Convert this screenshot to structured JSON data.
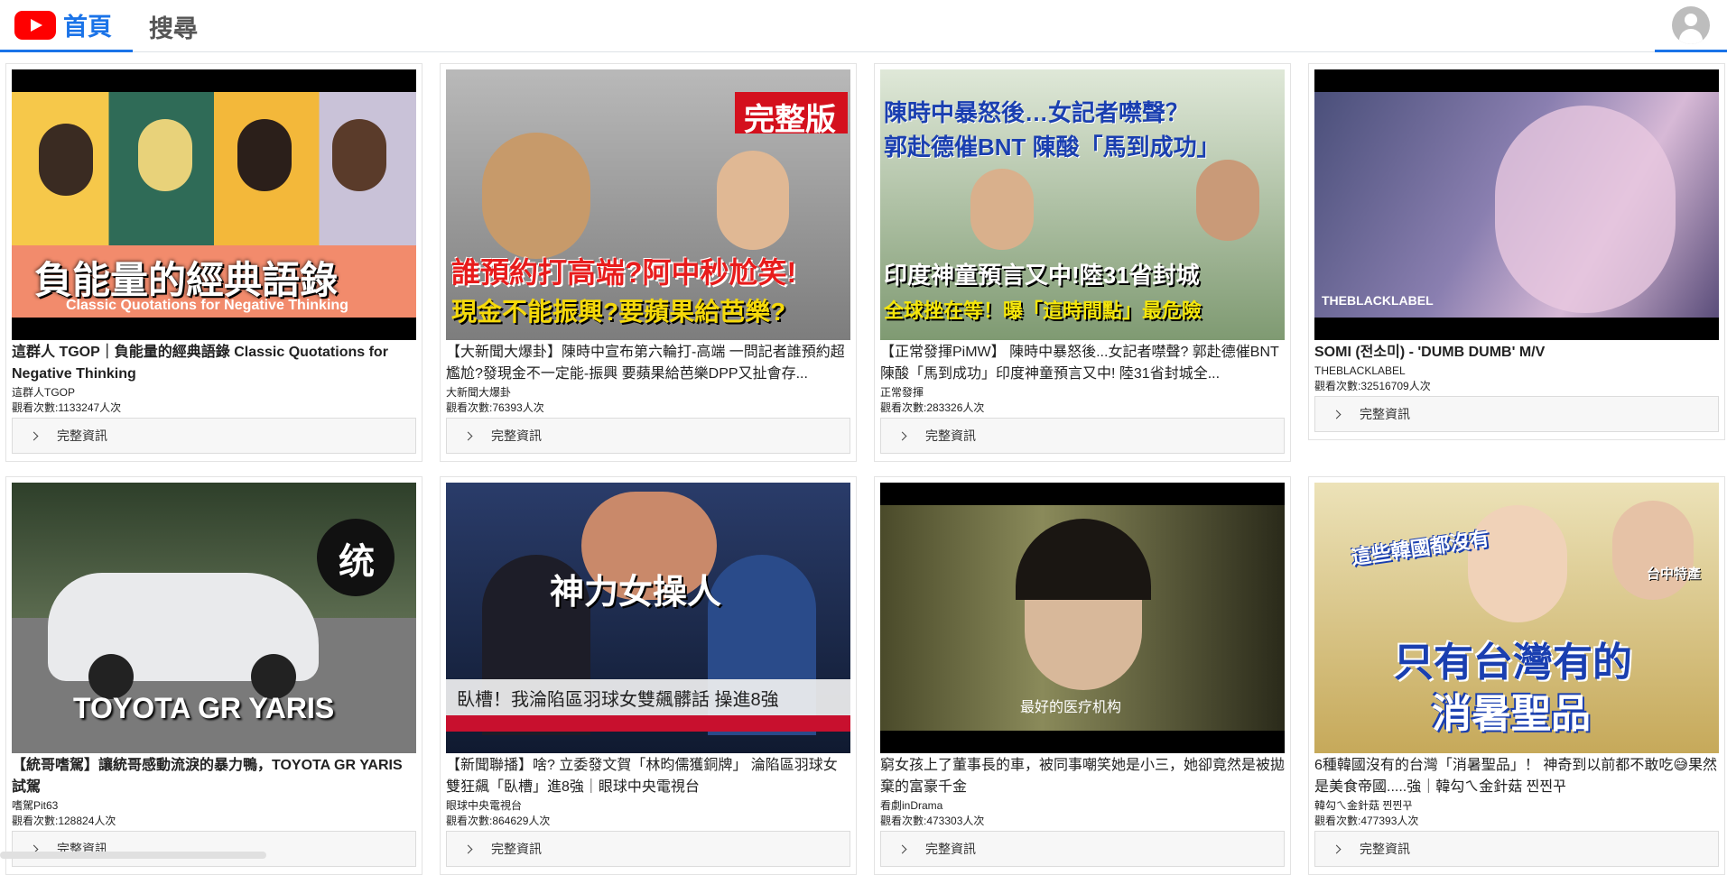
{
  "nav": {
    "home_label": "首頁",
    "search_label": "搜尋"
  },
  "details_label": "完整資訊",
  "videos": [
    {
      "title": "這群人 TGOP｜負能量的經典語錄 Classic Quotations for Negative Thinking",
      "channel": "這群人TGOP",
      "views": "觀看次數:1133247人次",
      "thumb_text": [
        "負能量的經典語錄",
        "Classic Quotations for Negative Thinking"
      ]
    },
    {
      "title": "【大新聞大爆卦】陳時中宣布第六輪打-高端 一問記者誰預約超尷尬?發現金不一定能-振興 要蘋果給芭樂DPP又扯會存...",
      "channel": "大新聞大爆卦",
      "views": "觀看次數:76393人次",
      "thumb_text": [
        "完整版",
        "誰預約打高端?阿中秒尬笑!",
        "現金不能振興?要蘋果給芭樂?"
      ]
    },
    {
      "title": "【正常發揮PiMW】 陳時中暴怒後...女記者噤聲? 郭赴德催BNT 陳酸「馬到成功」印度神童預言又中! 陸31省封城全...",
      "channel": "正常發揮",
      "views": "觀看次數:283326人次",
      "thumb_text": [
        "陳時中暴怒後…女記者噤聲？",
        "郭赴德催BNT 陳酸「馬到成功」",
        "印度神童預言又中!陸31省封城",
        "全球挫在等！曝「這時間點」最危險"
      ]
    },
    {
      "title": "SOMI (전소미) - 'DUMB DUMB' M/V",
      "channel": "THEBLACKLABEL",
      "views": "觀看次數:32516709人次",
      "thumb_text": [
        "THEBLACKLABEL"
      ]
    },
    {
      "title": "【統哥嗜駕】讓統哥感動流淚的暴力鴨，TOYOTA GR YARIS 試駕",
      "channel": "嗜駕Pit63",
      "views": "觀看次數:128824人次",
      "thumb_text": [
        "TOYOTA GR YARIS",
        "统"
      ]
    },
    {
      "title": "【新聞聯播】啥? 立委發文賀「林昀儒獲銅牌」 淪陷區羽球女雙狂飆「臥槽」進8強｜眼球中央電視台",
      "channel": "眼球中央電視台",
      "views": "觀看次數:864629人次",
      "thumb_text": [
        "神力女操人",
        "臥槽！我淪陷區羽球女雙飆髒話 操進8強"
      ]
    },
    {
      "title": "窮女孩上了董事長的車，被同事嘲笑她是小三，她卻竟然是被拋棄的富豪千金",
      "channel": "看劇inDrama",
      "views": "觀看次數:473303人次",
      "thumb_text": [
        "最好的医疗机构"
      ]
    },
    {
      "title": "6種韓國沒有的台灣「消暑聖品」！ 神奇到以前都不敢吃😅果然是美食帝國.....強｜韓勾ㄟ金針菇 찐찐꾸",
      "channel": "韓勾ㄟ金針菇 찐찐꾸",
      "views": "觀看次數:477393人次",
      "thumb_text": [
        "這些韓國都沒有",
        "台中特產",
        "只有台灣有的",
        "消暑聖品"
      ]
    }
  ]
}
